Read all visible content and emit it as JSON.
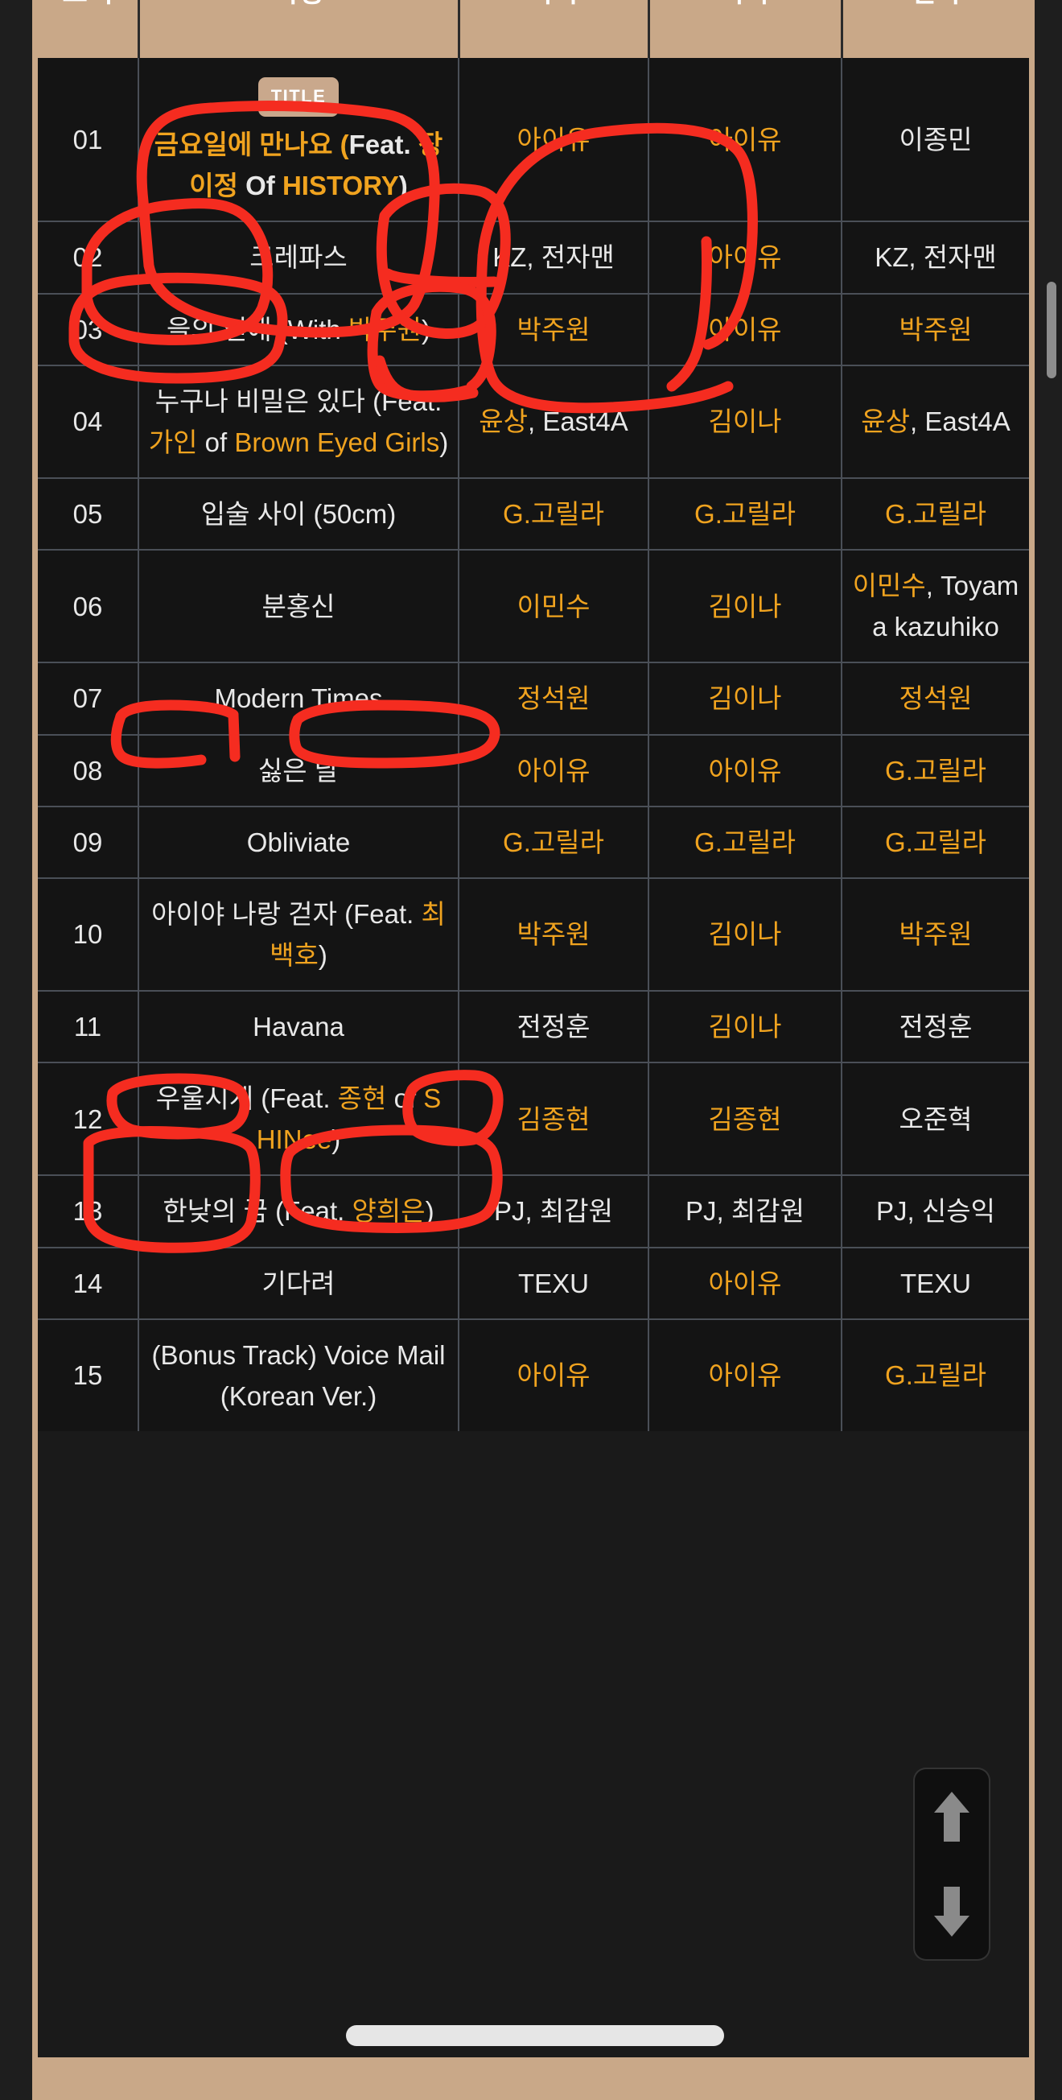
{
  "table": {
    "headers": [
      "트랙",
      "곡명",
      "작곡",
      "작사",
      "편곡"
    ],
    "title_badge": "TITLE",
    "rows": [
      {
        "track": "01",
        "title_parts": [
          {
            "t": "금요일에 만나요 (",
            "c": "hl"
          },
          {
            "t": "Feat. ",
            "c": "pl"
          },
          {
            "t": "장이정",
            "c": "hl"
          },
          {
            "t": " Of ",
            "c": "pl"
          },
          {
            "t": "HISTORY",
            "c": "hl"
          },
          {
            "t": ")",
            "c": "pl"
          }
        ],
        "composer_parts": [
          {
            "t": "아이유",
            "c": "hl"
          }
        ],
        "lyricist_parts": [
          {
            "t": "아이유",
            "c": "hl"
          }
        ],
        "arranger_parts": [
          {
            "t": "이종민",
            "c": "pl"
          }
        ],
        "is_title": true
      },
      {
        "track": "02",
        "title_parts": [
          {
            "t": "크레파스",
            "c": "pl"
          }
        ],
        "composer_parts": [
          {
            "t": "KZ, 전자맨",
            "c": "pl"
          }
        ],
        "lyricist_parts": [
          {
            "t": "아이유",
            "c": "hl"
          }
        ],
        "arranger_parts": [
          {
            "t": "KZ, 전자맨",
            "c": "pl"
          }
        ],
        "is_title": false
      },
      {
        "track": "03",
        "title_parts": [
          {
            "t": "을의 연애 (With ",
            "c": "pl"
          },
          {
            "t": "박주원",
            "c": "hl"
          },
          {
            "t": ")",
            "c": "pl"
          }
        ],
        "composer_parts": [
          {
            "t": "박주원",
            "c": "hl"
          }
        ],
        "lyricist_parts": [
          {
            "t": "아이유",
            "c": "hl"
          }
        ],
        "arranger_parts": [
          {
            "t": "박주원",
            "c": "hl"
          }
        ],
        "is_title": false
      },
      {
        "track": "04",
        "title_parts": [
          {
            "t": "누구나 비밀은 있다 (Feat. ",
            "c": "pl"
          },
          {
            "t": "가인",
            "c": "hl"
          },
          {
            "t": " of ",
            "c": "pl"
          },
          {
            "t": "Brown Eyed Girls",
            "c": "hl"
          },
          {
            "t": ")",
            "c": "pl"
          }
        ],
        "composer_parts": [
          {
            "t": "윤상",
            "c": "hl"
          },
          {
            "t": ", East4A",
            "c": "pl"
          }
        ],
        "lyricist_parts": [
          {
            "t": "김이나",
            "c": "hl"
          }
        ],
        "arranger_parts": [
          {
            "t": "윤상",
            "c": "hl"
          },
          {
            "t": ", East4A",
            "c": "pl"
          }
        ],
        "is_title": false
      },
      {
        "track": "05",
        "title_parts": [
          {
            "t": "입술 사이 (50cm)",
            "c": "pl"
          }
        ],
        "composer_parts": [
          {
            "t": "G.고릴라",
            "c": "hl"
          }
        ],
        "lyricist_parts": [
          {
            "t": "G.고릴라",
            "c": "hl"
          }
        ],
        "arranger_parts": [
          {
            "t": "G.고릴라",
            "c": "hl"
          }
        ],
        "is_title": false
      },
      {
        "track": "06",
        "title_parts": [
          {
            "t": "분홍신",
            "c": "pl"
          }
        ],
        "composer_parts": [
          {
            "t": "이민수",
            "c": "hl"
          }
        ],
        "lyricist_parts": [
          {
            "t": "김이나",
            "c": "hl"
          }
        ],
        "arranger_parts": [
          {
            "t": "이민수",
            "c": "hl"
          },
          {
            "t": ", Toyama kazuhiko",
            "c": "pl"
          }
        ],
        "is_title": false
      },
      {
        "track": "07",
        "title_parts": [
          {
            "t": "Modern Times",
            "c": "pl"
          }
        ],
        "composer_parts": [
          {
            "t": "정석원",
            "c": "hl"
          }
        ],
        "lyricist_parts": [
          {
            "t": "김이나",
            "c": "hl"
          }
        ],
        "arranger_parts": [
          {
            "t": "정석원",
            "c": "hl"
          }
        ],
        "is_title": false
      },
      {
        "track": "08",
        "title_parts": [
          {
            "t": "싫은 날",
            "c": "pl"
          }
        ],
        "composer_parts": [
          {
            "t": "아이유",
            "c": "hl"
          }
        ],
        "lyricist_parts": [
          {
            "t": "아이유",
            "c": "hl"
          }
        ],
        "arranger_parts": [
          {
            "t": "G.고릴라",
            "c": "hl"
          }
        ],
        "is_title": false
      },
      {
        "track": "09",
        "title_parts": [
          {
            "t": "Obliviate",
            "c": "pl"
          }
        ],
        "composer_parts": [
          {
            "t": "G.고릴라",
            "c": "hl"
          }
        ],
        "lyricist_parts": [
          {
            "t": "G.고릴라",
            "c": "hl"
          }
        ],
        "arranger_parts": [
          {
            "t": "G.고릴라",
            "c": "hl"
          }
        ],
        "is_title": false
      },
      {
        "track": "10",
        "title_parts": [
          {
            "t": "아이야 나랑 걷자 (Feat. ",
            "c": "pl"
          },
          {
            "t": "최백호",
            "c": "hl"
          },
          {
            "t": ")",
            "c": "pl"
          }
        ],
        "composer_parts": [
          {
            "t": "박주원",
            "c": "hl"
          }
        ],
        "lyricist_parts": [
          {
            "t": "김이나",
            "c": "hl"
          }
        ],
        "arranger_parts": [
          {
            "t": "박주원",
            "c": "hl"
          }
        ],
        "is_title": false
      },
      {
        "track": "11",
        "title_parts": [
          {
            "t": "Havana",
            "c": "pl"
          }
        ],
        "composer_parts": [
          {
            "t": "전정훈",
            "c": "pl"
          }
        ],
        "lyricist_parts": [
          {
            "t": "김이나",
            "c": "hl"
          }
        ],
        "arranger_parts": [
          {
            "t": "전정훈",
            "c": "pl"
          }
        ],
        "is_title": false
      },
      {
        "track": "12",
        "title_parts": [
          {
            "t": "우울시계 (Feat. ",
            "c": "pl"
          },
          {
            "t": "종현",
            "c": "hl"
          },
          {
            "t": " of ",
            "c": "pl"
          },
          {
            "t": "SHINee",
            "c": "hl"
          },
          {
            "t": ")",
            "c": "pl"
          }
        ],
        "composer_parts": [
          {
            "t": "김종현",
            "c": "hl"
          }
        ],
        "lyricist_parts": [
          {
            "t": "김종현",
            "c": "hl"
          }
        ],
        "arranger_parts": [
          {
            "t": "오준혁",
            "c": "pl"
          }
        ],
        "is_title": false
      },
      {
        "track": "13",
        "title_parts": [
          {
            "t": "한낮의 꿈 (Feat. ",
            "c": "pl"
          },
          {
            "t": "양희은",
            "c": "hl"
          },
          {
            "t": ")",
            "c": "pl"
          }
        ],
        "composer_parts": [
          {
            "t": "PJ, 최갑원",
            "c": "pl"
          }
        ],
        "lyricist_parts": [
          {
            "t": "PJ, 최갑원",
            "c": "pl"
          }
        ],
        "arranger_parts": [
          {
            "t": "PJ, 신승익",
            "c": "pl"
          }
        ],
        "is_title": false
      },
      {
        "track": "14",
        "title_parts": [
          {
            "t": "기다려",
            "c": "pl"
          }
        ],
        "composer_parts": [
          {
            "t": "TEXU",
            "c": "pl"
          }
        ],
        "lyricist_parts": [
          {
            "t": "아이유",
            "c": "hl"
          }
        ],
        "arranger_parts": [
          {
            "t": "TEXU",
            "c": "pl"
          }
        ],
        "is_title": false
      },
      {
        "track": "15",
        "title_parts": [
          {
            "t": "(Bonus Track) Voice Mail (Korean Ver.)",
            "c": "pl"
          }
        ],
        "composer_parts": [
          {
            "t": "아이유",
            "c": "hl"
          }
        ],
        "lyricist_parts": [
          {
            "t": "아이유",
            "c": "hl"
          }
        ],
        "arranger_parts": [
          {
            "t": "G.고릴라",
            "c": "hl"
          }
        ],
        "is_title": false
      }
    ]
  },
  "scroll_widget": {
    "up_icon": "arrow-up-icon",
    "down_icon": "arrow-down-icon"
  },
  "colors": {
    "accent_orange": "#f0a31f",
    "header_tan": "#c9a888",
    "cell_bg": "#141414",
    "page_bg": "#1e1e1e",
    "annotation_red": "#f52c20"
  }
}
